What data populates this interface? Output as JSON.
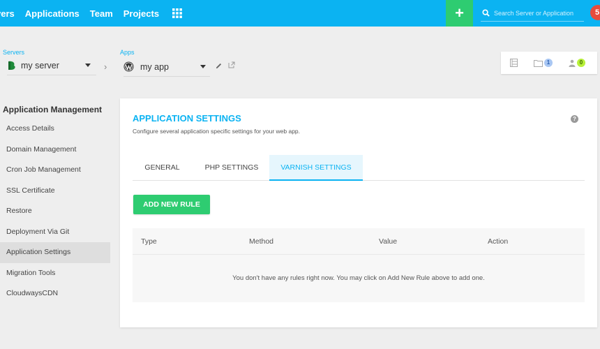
{
  "topbar": {
    "nav": [
      "vers",
      "Applications",
      "Team",
      "Projects"
    ],
    "search_placeholder": "Search Server or Application",
    "plus_label": "+",
    "notification_count": "5",
    "colors": {
      "bar": "#0bb3f2",
      "plus": "#2ecc71",
      "notification": "#e74c3c"
    }
  },
  "servers": {
    "label": "Servers",
    "selected": "my server"
  },
  "apps": {
    "label": "Apps",
    "selected": "my app"
  },
  "widget": {
    "folder_count": "1",
    "user_count": "0"
  },
  "sidebar": {
    "title": "Application Management",
    "items": [
      "Access Details",
      "Domain Management",
      "Cron Job Management",
      "SSL Certificate",
      "Restore",
      "Deployment Via Git",
      "Application Settings",
      "Migration Tools",
      "CloudwaysCDN"
    ],
    "active_index": 6
  },
  "panel": {
    "title": "APPLICATION SETTINGS",
    "subtitle": "Configure several application specific settings for your web app.",
    "help": "?",
    "tabs": [
      "GENERAL",
      "PHP SETTINGS",
      "VARNISH SETTINGS"
    ],
    "active_tab": 2,
    "add_button": "ADD NEW RULE",
    "table": {
      "columns": [
        "Type",
        "Method",
        "Value",
        "Action"
      ],
      "empty_message": "You don't have any rules right now. You may click on Add New Rule above to add one."
    }
  }
}
